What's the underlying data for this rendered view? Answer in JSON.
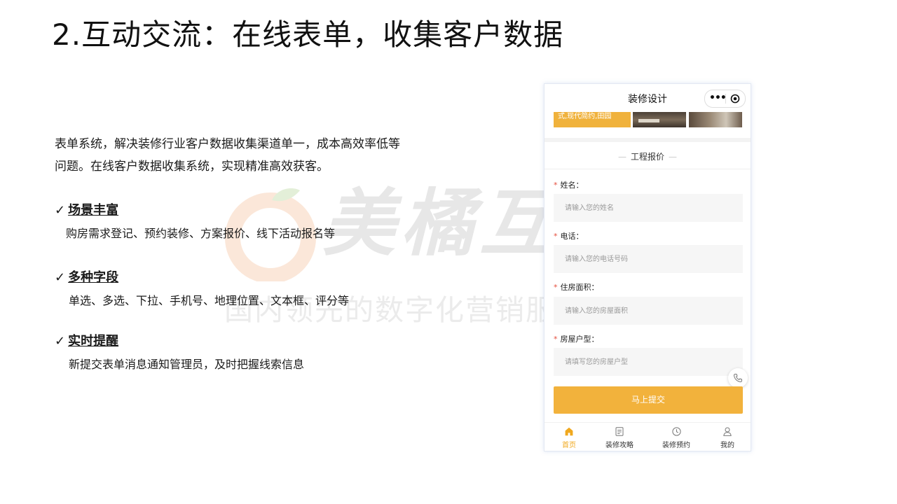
{
  "slide": {
    "title": "2.互动交流：在线表单，收集客户数据",
    "intro_line1": "表单系统，解决装修行业客户数据收集渠道单一，成本高效率低等",
    "intro_line2": "问题。在线客户数据收集系统，实现精准高效获客。",
    "features": [
      {
        "check": "✓",
        "title": "场景丰富",
        "desc": "购房需求登记、预约装修、方案报价、线下活动报名等"
      },
      {
        "check": "✓",
        "title": "多种字段",
        "desc": "单选、多选、下拉、手机号、地理位置、文本框、评分等"
      },
      {
        "check": "✓",
        "title": "实时提醒",
        "desc": "新提交表单消息通知管理员，及时把握线索信息"
      }
    ]
  },
  "watermark": {
    "main": "美橘互联",
    "sub": "国内领先的数字化营销服务商"
  },
  "phone": {
    "nav_title": "装修设计",
    "capsule_more": "•••",
    "banner_tag": "式,现代简约,田园",
    "section_title": "工程报价",
    "section_dash": "—",
    "required_mark": "*",
    "fields": [
      {
        "label": "姓名：",
        "placeholder": "请输入您的姓名"
      },
      {
        "label": "电话：",
        "placeholder": "请输入您的电话号码"
      },
      {
        "label": "住房面积：",
        "placeholder": "请输入您的房屋面积"
      },
      {
        "label": "房屋户型：",
        "placeholder": "请填写您的房屋户型"
      }
    ],
    "submit_label": "马上提交",
    "tabs": [
      {
        "label": "首页",
        "icon": "home-icon"
      },
      {
        "label": "装修攻略",
        "icon": "document-icon"
      },
      {
        "label": "装修预约",
        "icon": "clock-icon"
      },
      {
        "label": "我的",
        "icon": "user-icon"
      }
    ]
  },
  "colors": {
    "accent": "#f2b23c",
    "active_tab": "#f0a81e",
    "required": "#e54d3c",
    "input_bg": "#f6f6f6"
  }
}
